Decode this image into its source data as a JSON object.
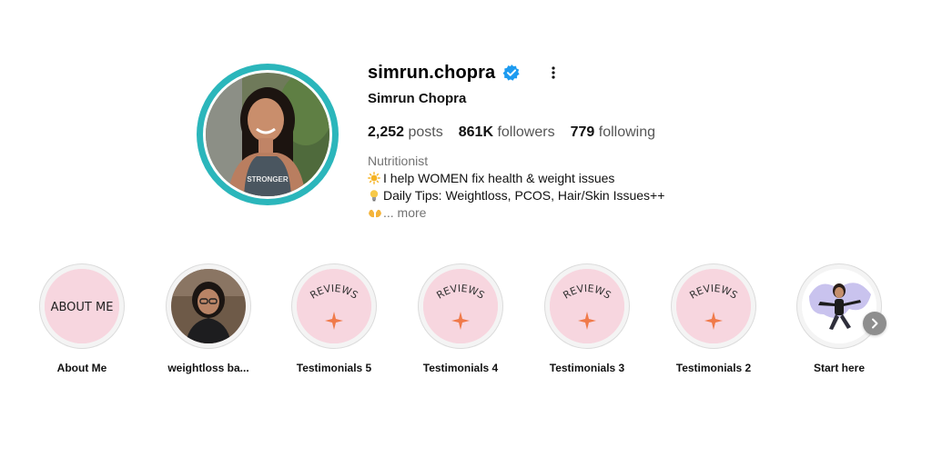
{
  "profile": {
    "username": "simrun.chopra",
    "verified": true,
    "full_name": "Simrun Chopra",
    "avatar_shirt_text": "STRONGER",
    "stats": {
      "posts_count": "2,252",
      "posts_label": "posts",
      "followers_count": "861K",
      "followers_label": "followers",
      "following_count": "779",
      "following_label": "following"
    },
    "bio": {
      "category": "Nutritionist",
      "line1": "I help WOMEN fix health & weight issues",
      "line1_icon": "sun-emoji",
      "line2": "Daily Tips: Weightloss, PCOS, Hair/Skin Issues++",
      "line2_icon": "lightbulb-emoji",
      "line3_icon": "hands-emoji",
      "more_label": "... more"
    }
  },
  "highlights": [
    {
      "label": "About Me",
      "cover_text": "ABOUT ME",
      "cover": "text"
    },
    {
      "label": "weightloss ba...",
      "cover": "photo"
    },
    {
      "label": "Testimonials 5",
      "cover_text": "REVIEWS",
      "cover": "reviews"
    },
    {
      "label": "Testimonials 4",
      "cover_text": "REVIEWS",
      "cover": "reviews"
    },
    {
      "label": "Testimonials 3",
      "cover_text": "REVIEWS",
      "cover": "reviews"
    },
    {
      "label": "Testimonials 2",
      "cover_text": "REVIEWS",
      "cover": "reviews"
    },
    {
      "label": "Start here",
      "cover": "avatar-sticker"
    }
  ],
  "colors": {
    "avatar_ring": "#2bb6bb",
    "verified_badge": "#1d9bf0",
    "highlight_pink": "#f7d6df",
    "sparkle_orange": "#f07a4a"
  }
}
